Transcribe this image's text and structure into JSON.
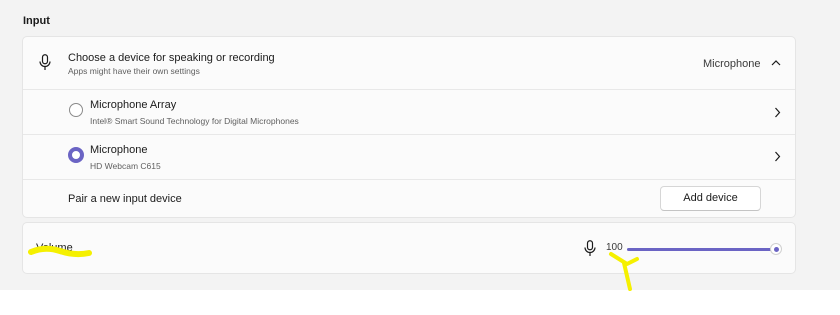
{
  "section": {
    "title": "Input"
  },
  "device_chooser": {
    "title": "Choose a device for speaking or recording",
    "subtitle": "Apps might have their own settings",
    "selected_value": "Microphone",
    "icon": "microphone-icon",
    "expand_icon": "chevron-up-icon"
  },
  "devices": [
    {
      "name": "Microphone Array",
      "description": "Intel® Smart Sound Technology for Digital Microphones",
      "selected": false
    },
    {
      "name": "Microphone",
      "description": "HD Webcam C615",
      "selected": true
    }
  ],
  "pair_device": {
    "label": "Pair a new input device",
    "button_label": "Add device"
  },
  "volume": {
    "label": "Volume",
    "value": "100",
    "level_percent": 100,
    "icon": "microphone-icon"
  },
  "colors": {
    "accent": "#6b64c4",
    "highlight_annotation": "#f5f000"
  }
}
